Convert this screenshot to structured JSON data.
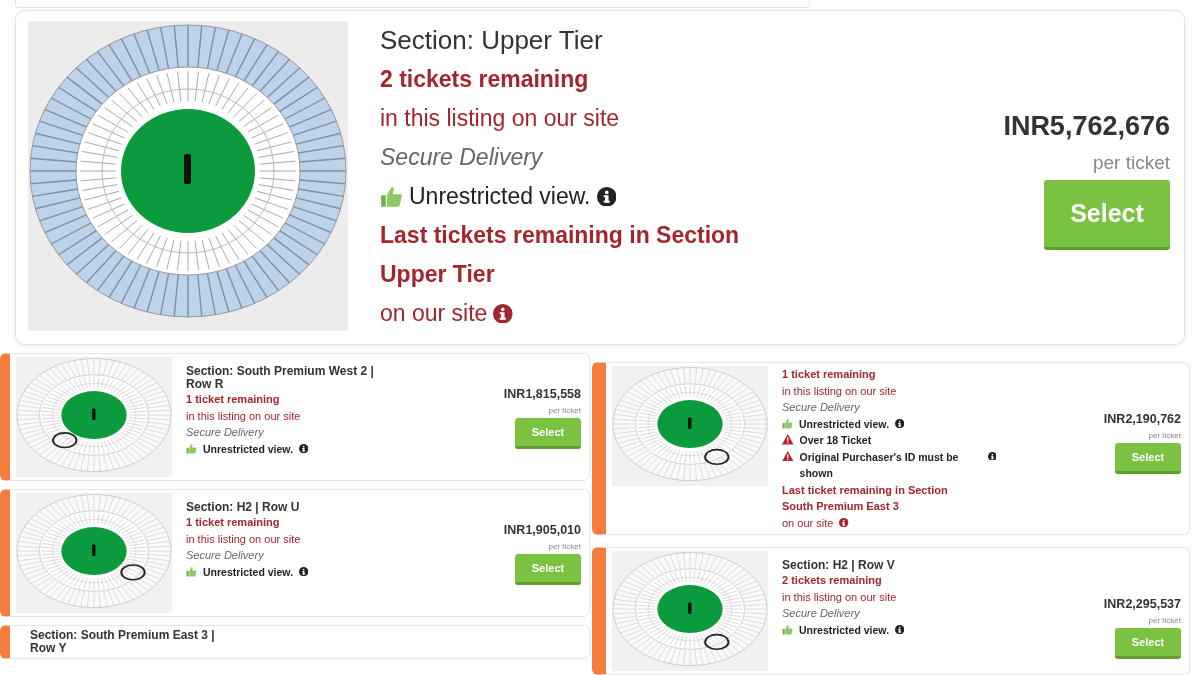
{
  "featured": {
    "section": "Section: Upper Tier",
    "remaining": "2 tickets remaining",
    "listing_note": "in this listing on our site",
    "delivery": "Secure Delivery",
    "view": "Unrestricted view.",
    "last_notice": [
      "Last tickets remaining in Section",
      "Upper Tier",
      "on our site"
    ],
    "price": "INR5,762,676",
    "price_unit": "per ticket",
    "button": "Select",
    "map": {
      "kind": "outer-ring"
    }
  },
  "left_column": [
    {
      "section": "Section: South Premium West 2 | Row R",
      "remaining": "1 ticket remaining",
      "listing_note": "in this listing on our site",
      "delivery": "Secure Delivery",
      "view": "Unrestricted view.",
      "price": "INR1,815,558",
      "price_unit": "per ticket",
      "button": "Select",
      "map": {
        "kind": "marker-south-west"
      }
    },
    {
      "section": "Section: H2 | Row U",
      "remaining": "1 ticket remaining",
      "listing_note": "in this listing on our site",
      "delivery": "Secure Delivery",
      "view": "Unrestricted view.",
      "price": "INR1,905,010",
      "price_unit": "per ticket",
      "button": "Select",
      "map": {
        "kind": "marker-east"
      }
    },
    {
      "section": "Section: South Premium East 3 | Row Y"
    }
  ],
  "right_column": [
    {
      "remaining": "1 ticket remaining",
      "listing_note": "in this listing on our site",
      "delivery": "Secure Delivery",
      "view": "Unrestricted view.",
      "warnings": [
        "Over 18 Ticket",
        "Original Purchaser's ID must be shown"
      ],
      "last_notice": [
        "Last ticket remaining in Section",
        "South Premium East 3",
        "on our site"
      ],
      "price": "INR2,190,762",
      "price_unit": "per ticket",
      "button": "Select",
      "map": {
        "kind": "marker-south-east"
      }
    },
    {
      "section": "Section: H2 | Row V",
      "remaining": "2 tickets remaining",
      "listing_note": "in this listing on our site",
      "delivery": "Secure Delivery",
      "view": "Unrestricted view.",
      "price": "INR2,295,537",
      "price_unit": "per ticket",
      "button": "Select",
      "map": {
        "kind": "marker-south-east"
      }
    }
  ]
}
